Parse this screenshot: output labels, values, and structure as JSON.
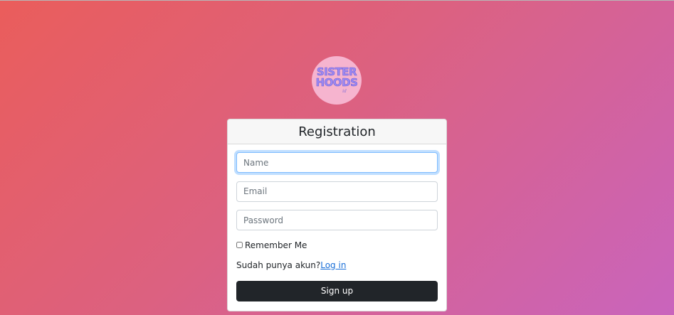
{
  "logo": {
    "line1": "SISTER",
    "line2": "HOODS",
    "sub": "id"
  },
  "form": {
    "title": "Registration",
    "name_placeholder": "Name",
    "email_placeholder": "Email",
    "password_placeholder": "Password",
    "remember_label": "Remember Me",
    "login_prompt": "Sudah punya akun?",
    "login_link": "Log in",
    "signup_label": "Sign up"
  },
  "colors": {
    "gradient_start": "#ea5d5b",
    "gradient_end": "#c964bd",
    "button": "#212529",
    "link": "#1a6fd8"
  }
}
